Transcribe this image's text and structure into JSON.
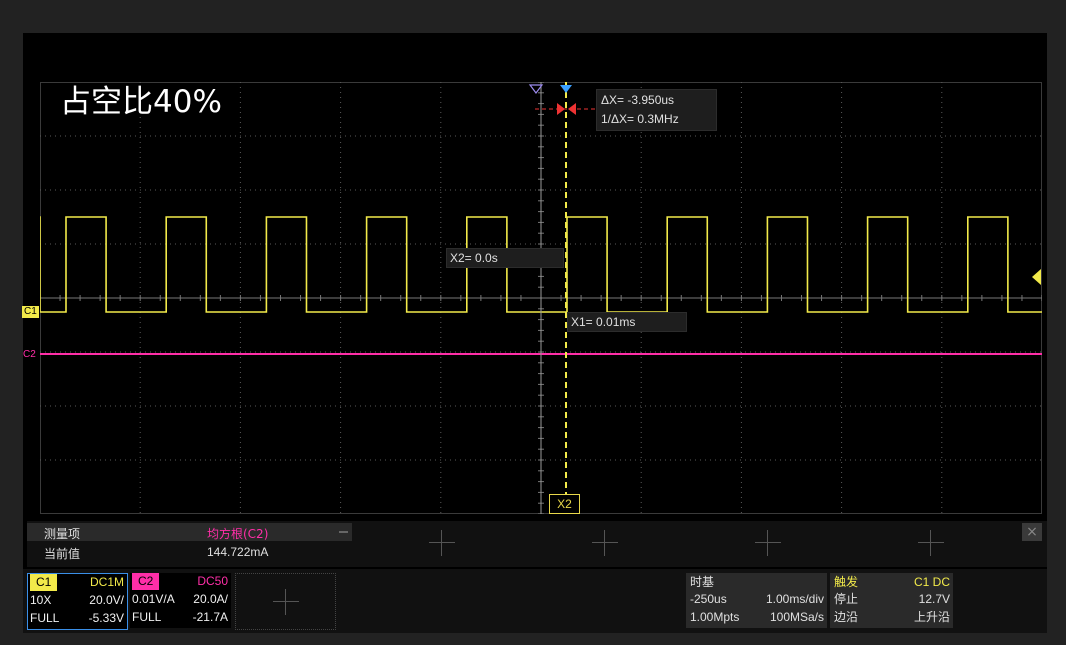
{
  "screen_title": "占空比40%",
  "cursors": {
    "delta_x": "ΔX= -3.950us",
    "inv_delta_x": "1/ΔX= 0.3MHz",
    "x2": "X2= 0.0s",
    "x1": "X1= 0.01ms",
    "x2_tag": "X2"
  },
  "channel_markers": {
    "c1": "C1",
    "c2": "C2"
  },
  "colors": {
    "c1": "#f2ea4a",
    "c2": "#ff2ea8",
    "grid": "#5a5a5a"
  },
  "measurement": {
    "header_label": "测量项",
    "value_label": "当前值",
    "item_name": "均方根(C2)",
    "item_value": "144.722mA",
    "close_icon": "×"
  },
  "channel1": {
    "name": "C1",
    "coupling": "DC1M",
    "probe": "10X",
    "scale": "20.0V/",
    "bandwidth": "FULL",
    "offset": "-5.33V"
  },
  "channel2": {
    "name": "C2",
    "coupling": "DC50",
    "probe": "0.01V/A",
    "scale": "20.0A/",
    "bandwidth": "FULL",
    "offset": "-21.7A"
  },
  "timebase": {
    "label": "时基",
    "delay": "-250us",
    "scale": "1.00ms/div",
    "memory": "1.00Mpts",
    "sample_rate": "100MSa/s"
  },
  "trigger": {
    "label": "触发",
    "source": "C1 DC",
    "state": "停止",
    "level": "12.7V",
    "slope_label": "边沿",
    "slope": "上升沿"
  }
}
